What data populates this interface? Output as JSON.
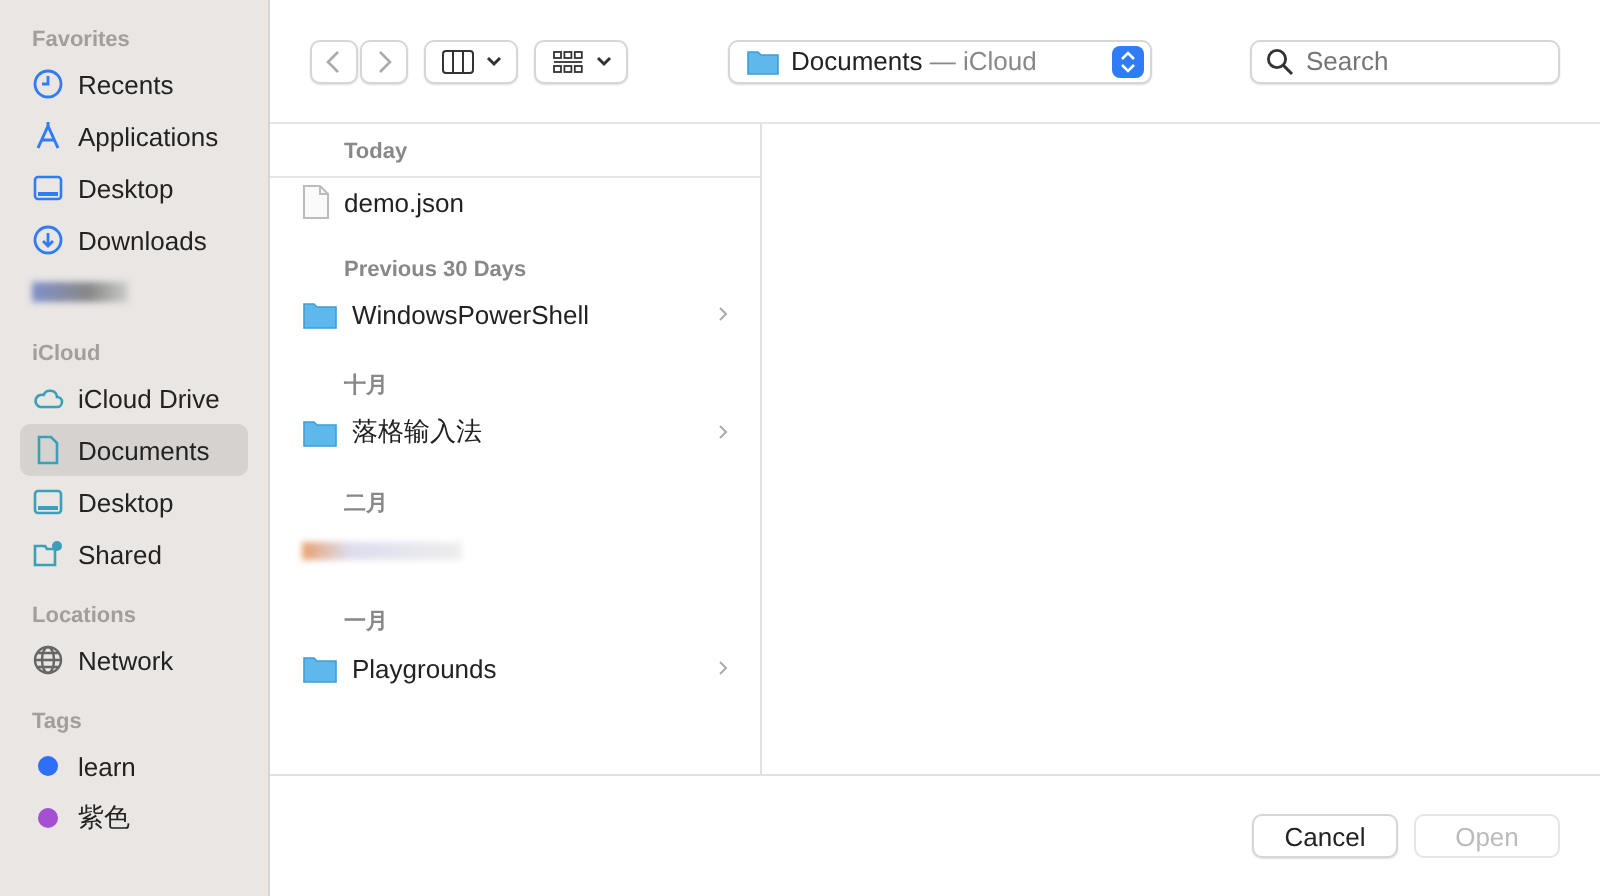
{
  "sidebar": {
    "sections": [
      {
        "title": "Favorites",
        "items": [
          {
            "kind": "clock",
            "label": "Recents",
            "selected": false
          },
          {
            "kind": "apps",
            "label": "Applications",
            "selected": false
          },
          {
            "kind": "desktop",
            "label": "Desktop",
            "selected": false
          },
          {
            "kind": "download",
            "label": "Downloads",
            "selected": false
          },
          {
            "kind": "blurred",
            "selected": false
          }
        ]
      },
      {
        "title": "iCloud",
        "items": [
          {
            "kind": "cloud",
            "label": "iCloud Drive",
            "selected": false
          },
          {
            "kind": "doc",
            "label": "Documents",
            "selected": true
          },
          {
            "kind": "desktop2",
            "label": "Desktop",
            "selected": false
          },
          {
            "kind": "shared",
            "label": "Shared",
            "selected": false
          }
        ]
      },
      {
        "title": "Locations",
        "items": [
          {
            "kind": "network",
            "label": "Network",
            "selected": false
          }
        ]
      },
      {
        "title": "Tags",
        "items": [
          {
            "kind": "tag",
            "label": "learn",
            "color": "#2f6ef6",
            "selected": false
          },
          {
            "kind": "tag",
            "label": "紫色",
            "color": "#a550d0",
            "selected": false
          }
        ]
      }
    ]
  },
  "toolbar": {
    "location": "Documents",
    "location_suffix": "— iCloud",
    "search": {
      "placeholder": "Search"
    }
  },
  "files": [
    {
      "group": "Today",
      "items": [
        {
          "kind": "file",
          "name": "demo.json",
          "has_children": false
        }
      ]
    },
    {
      "group": "Previous 30 Days",
      "items": [
        {
          "kind": "folder",
          "name": "WindowsPowerShell",
          "has_children": true
        }
      ]
    },
    {
      "group": "十月",
      "items": [
        {
          "kind": "folder",
          "name": "落格输入法",
          "has_children": true
        }
      ]
    },
    {
      "group": "二月",
      "items": [
        {
          "kind": "blurred",
          "has_children": false
        }
      ]
    },
    {
      "group": "一月",
      "items": [
        {
          "kind": "folder",
          "name": "Playgrounds",
          "has_children": true
        }
      ]
    }
  ],
  "buttons": [
    {
      "label": "Cancel",
      "disabled": false
    },
    {
      "label": "Open",
      "disabled": true
    }
  ]
}
